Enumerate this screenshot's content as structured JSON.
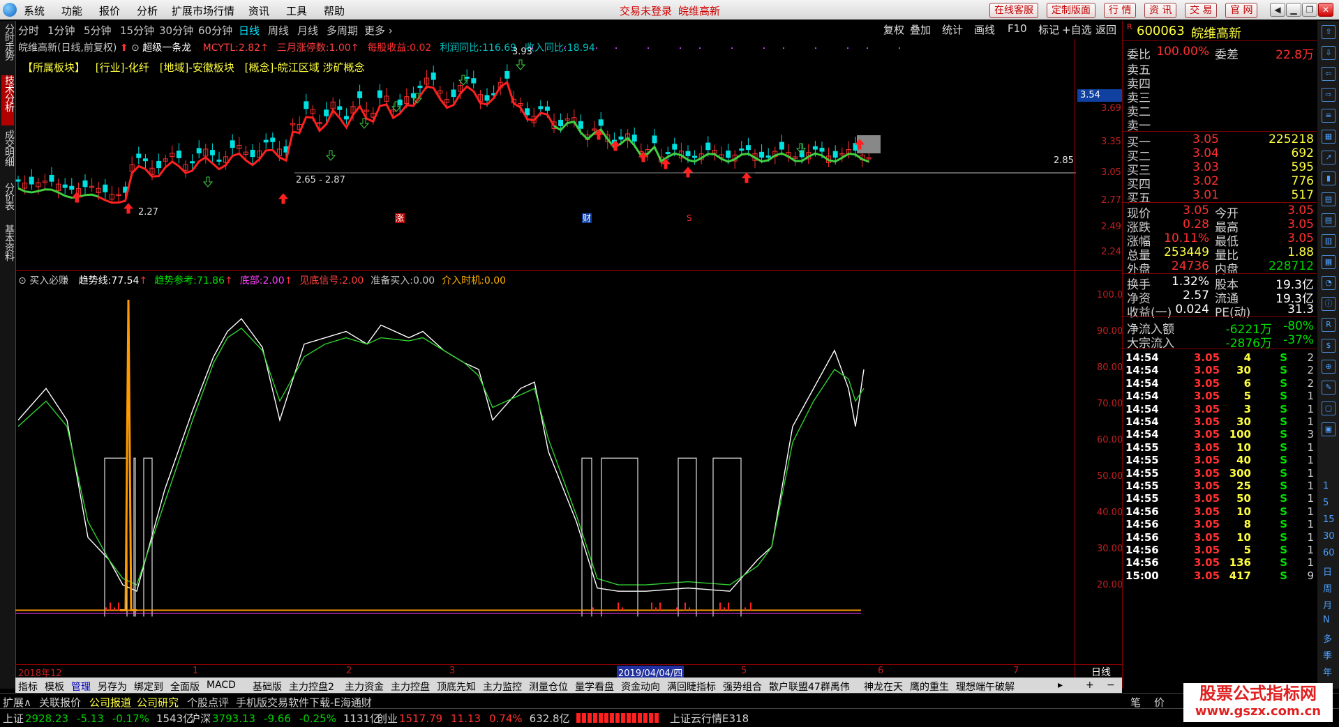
{
  "menu": {
    "items": [
      "系统",
      "功能",
      "报价",
      "分析",
      "扩展市场行情",
      "资讯",
      "工具",
      "帮助"
    ],
    "login_status": "交易未登录",
    "stock_title": "皖维高新",
    "buttons": [
      "在线客服",
      "定制版面",
      "行 情",
      "资 讯",
      "交 易",
      "官 网"
    ]
  },
  "periods": [
    "分时",
    "1分钟",
    "5分钟",
    "15分钟",
    "30分钟",
    "60分钟",
    "日线",
    "周线",
    "月线",
    "多周期",
    "更多"
  ],
  "active_period": "日线",
  "right_tools": [
    "复权",
    "叠加",
    "统计",
    "画线",
    "F10",
    "标记",
    "+自选",
    "返回"
  ],
  "left_tabs": [
    "分时走势",
    "技术分析",
    "成交明细",
    "分价表",
    "基本资料"
  ],
  "price_panel": {
    "header_name": "皖维高新(日线,前复权)",
    "indicator_name": "超级一条龙",
    "fields": [
      {
        "label": "MCYTL:",
        "value": "2.82",
        "color": "#ff4040"
      },
      {
        "label": "三月涨停数:",
        "value": "1.00",
        "color": "#ff4040"
      },
      {
        "label": "每股收益:",
        "value": "0.02",
        "color": "#ff3030"
      },
      {
        "label": "利润同比:",
        "value": "116.69",
        "color": "#00c0c0"
      },
      {
        "label": "收入同比:",
        "value": "18.94",
        "color": "#00c0c0"
      }
    ],
    "sectors": [
      "【所属板块】",
      "[行业]-化纤",
      "[地域]-安徽板块",
      "[概念]-皖江区域 涉矿概念"
    ],
    "y_ticks": [
      "3.69",
      "3.35",
      "3.05",
      "2.77",
      "2.49",
      "2.24"
    ],
    "current_price_label": "3.54",
    "labels": {
      "high": "3.93",
      "low": "2.27",
      "range": "2.65 - 2.87",
      "right": "2.85"
    },
    "markers": {
      "zhang": "涨",
      "cai": "财",
      "s": "S"
    }
  },
  "indicator_panel": {
    "name": "买入必赚",
    "fields": [
      {
        "label": "趋势线:",
        "value": "77.54",
        "color": "#ffffff"
      },
      {
        "label": "趋势参考:",
        "value": "71.86",
        "color": "#00e000"
      },
      {
        "label": "底部:",
        "value": "2.00",
        "color": "#ff40ff"
      },
      {
        "label": "见底信号:",
        "value": "2.00",
        "color": "#ff4040"
      },
      {
        "label": "准备买入:",
        "value": "0.00",
        "color": "#c0c0c0"
      },
      {
        "label": "介入时机:",
        "value": "0.00",
        "color": "#ffb000"
      }
    ],
    "y_ticks": [
      "100.0",
      "90.00",
      "80.00",
      "70.00",
      "60.00",
      "50.00",
      "40.00",
      "30.00",
      "20.00"
    ]
  },
  "x_axis": {
    "labels": [
      "2018年12",
      "1",
      "2",
      "3",
      "2019/04/04/四",
      "5",
      "6",
      "7"
    ],
    "period_label": "日线"
  },
  "quote": {
    "code": "600063",
    "name": "皖维高新",
    "weibi_label": "委比",
    "weibi": "100.00%",
    "weicha_label": "委差",
    "weicha": "22.8万",
    "asks": [
      {
        "label": "卖五",
        "price": "",
        "vol": ""
      },
      {
        "label": "卖四",
        "price": "",
        "vol": ""
      },
      {
        "label": "卖三",
        "price": "",
        "vol": ""
      },
      {
        "label": "卖二",
        "price": "",
        "vol": ""
      },
      {
        "label": "卖一",
        "price": "",
        "vol": ""
      }
    ],
    "bids": [
      {
        "label": "买一",
        "price": "3.05",
        "vol": "225218"
      },
      {
        "label": "买二",
        "price": "3.04",
        "vol": "692"
      },
      {
        "label": "买三",
        "price": "3.03",
        "vol": "595"
      },
      {
        "label": "买四",
        "price": "3.02",
        "vol": "776"
      },
      {
        "label": "买五",
        "price": "3.01",
        "vol": "517"
      }
    ],
    "stats": [
      {
        "l1": "现价",
        "v1": "3.05",
        "l2": "今开",
        "v2": "3.05",
        "c1": "#ff3030",
        "c2": "#ff3030"
      },
      {
        "l1": "涨跌",
        "v1": "0.28",
        "l2": "最高",
        "v2": "3.05",
        "c1": "#ff3030",
        "c2": "#ff3030"
      },
      {
        "l1": "涨幅",
        "v1": "10.11%",
        "l2": "最低",
        "v2": "3.05",
        "c1": "#ff3030",
        "c2": "#ff3030"
      },
      {
        "l1": "总量",
        "v1": "253449",
        "l2": "量比",
        "v2": "1.88",
        "c1": "#ffff40",
        "c2": "#ffff40"
      },
      {
        "l1": "外盘",
        "v1": "24736",
        "l2": "内盘",
        "v2": "228712",
        "c1": "#ff3030",
        "c2": "#00d000"
      }
    ],
    "stats2": [
      {
        "l1": "换手",
        "v1": "1.32%",
        "l2": "股本",
        "v2": "19.3亿"
      },
      {
        "l1": "净资",
        "v1": "2.57",
        "l2": "流通",
        "v2": "19.3亿"
      },
      {
        "l1": "收益(一)",
        "v1": "0.024",
        "l2": "PE(动)",
        "v2": "31.3"
      }
    ],
    "flows": [
      {
        "label": "净流入额",
        "v1": "-6221万",
        "v2": "-80%"
      },
      {
        "label": "大宗流入",
        "v1": "-2876万",
        "v2": "-37%"
      }
    ],
    "ticks": [
      {
        "t": "14:54",
        "p": "3.05",
        "v": "4",
        "s": "S",
        "n": "2"
      },
      {
        "t": "14:54",
        "p": "3.05",
        "v": "30",
        "s": "S",
        "n": "2"
      },
      {
        "t": "14:54",
        "p": "3.05",
        "v": "6",
        "s": "S",
        "n": "2"
      },
      {
        "t": "14:54",
        "p": "3.05",
        "v": "5",
        "s": "S",
        "n": "1"
      },
      {
        "t": "14:54",
        "p": "3.05",
        "v": "3",
        "s": "S",
        "n": "1"
      },
      {
        "t": "14:54",
        "p": "3.05",
        "v": "30",
        "s": "S",
        "n": "1"
      },
      {
        "t": "14:54",
        "p": "3.05",
        "v": "100",
        "s": "S",
        "n": "3"
      },
      {
        "t": "14:55",
        "p": "3.05",
        "v": "10",
        "s": "S",
        "n": "1"
      },
      {
        "t": "14:55",
        "p": "3.05",
        "v": "40",
        "s": "S",
        "n": "1"
      },
      {
        "t": "14:55",
        "p": "3.05",
        "v": "300",
        "s": "S",
        "n": "1"
      },
      {
        "t": "14:55",
        "p": "3.05",
        "v": "25",
        "s": "S",
        "n": "1"
      },
      {
        "t": "14:55",
        "p": "3.05",
        "v": "50",
        "s": "S",
        "n": "1"
      },
      {
        "t": "14:56",
        "p": "3.05",
        "v": "10",
        "s": "S",
        "n": "1"
      },
      {
        "t": "14:56",
        "p": "3.05",
        "v": "8",
        "s": "S",
        "n": "1"
      },
      {
        "t": "14:56",
        "p": "3.05",
        "v": "10",
        "s": "S",
        "n": "1"
      },
      {
        "t": "14:56",
        "p": "3.05",
        "v": "5",
        "s": "S",
        "n": "1"
      },
      {
        "t": "14:56",
        "p": "3.05",
        "v": "136",
        "s": "S",
        "n": "1"
      },
      {
        "t": "15:00",
        "p": "3.05",
        "v": "417",
        "s": "S",
        "n": "9"
      }
    ]
  },
  "bottom_tabs": [
    "指标",
    "模板",
    "管理",
    "另存为",
    "绑定到",
    "全面版",
    "MACD",
    "基础版",
    "主力控盘2",
    "主力资金",
    "主力控盘",
    "顶底先知",
    "主力监控",
    "测量仓位",
    "量学看盘",
    "资金动向",
    "满回睫指标",
    "强势组合",
    "散户联盟47群禹伟",
    "神龙在天",
    "鹰的重生",
    "理想端午破解"
  ],
  "status_row1": [
    "扩展∧",
    "关联报价",
    "公司报道",
    "公司研究",
    "个股点评",
    "手机版交易软件下载-E海通财"
  ],
  "status_row1_right": [
    "笔",
    "价"
  ],
  "index_bar": [
    {
      "name": "上证",
      "value": "2928.23",
      "chg": "-5.13",
      "pct": "-0.17%",
      "amt": "1543亿"
    },
    {
      "name": "沪深",
      "value": "3793.13",
      "chg": "-9.66",
      "pct": "-0.25%",
      "amt": "1131亿"
    },
    {
      "name": "创业",
      "value": "1517.79",
      "chg": "11.13",
      "pct": "0.74%",
      "amt": "632.8亿"
    }
  ],
  "cloud_label": "上证云行情E318",
  "watermark": {
    "line1": "股票公式指标网",
    "line2": "www.gszx.com.cn"
  },
  "colors": {
    "up": "#ff3030",
    "down": "#00e0e0",
    "ma_up": "#ff2020",
    "ma_down": "#40d040",
    "accent": "#c00000"
  }
}
